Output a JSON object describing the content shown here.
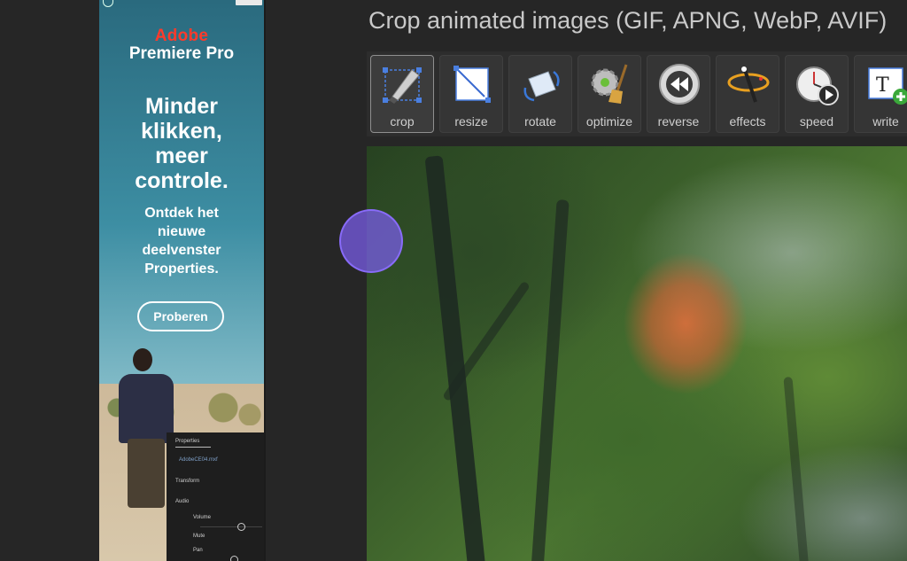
{
  "page": {
    "title": "Crop animated images (GIF, APNG, WebP, AVIF)"
  },
  "toolbar": {
    "tools": [
      {
        "label": "crop",
        "icon": "crop-icon",
        "active": true
      },
      {
        "label": "resize",
        "icon": "resize-icon",
        "active": false
      },
      {
        "label": "rotate",
        "icon": "rotate-icon",
        "active": false
      },
      {
        "label": "optimize",
        "icon": "optimize-icon",
        "active": false
      },
      {
        "label": "reverse",
        "icon": "reverse-icon",
        "active": false
      },
      {
        "label": "effects",
        "icon": "effects-icon",
        "active": false
      },
      {
        "label": "speed",
        "icon": "speed-icon",
        "active": false
      },
      {
        "label": "write",
        "icon": "write-icon",
        "active": false
      }
    ]
  },
  "ad": {
    "brand": "Adobe",
    "product": "Premiere Pro",
    "headline_lines": [
      "Minder",
      "klikken,",
      "meer",
      "controle."
    ],
    "sub_lines": [
      "Ontdek het",
      "nieuwe",
      "deelvenster",
      "Properties."
    ],
    "cta": "Proberen",
    "ui_panel": {
      "header": "Properties",
      "file": "AdobeCE04.mxf",
      "items": [
        "Transform",
        "Audio",
        "Volume",
        "Mute",
        "Pan"
      ]
    }
  },
  "image": {
    "icon": "animated-image-preview"
  },
  "colors": {
    "background": "#262626",
    "toolbar": "#2d2d2d",
    "accent_cursor": "#7a5ce6",
    "adobe_red": "#ff3a2b"
  }
}
